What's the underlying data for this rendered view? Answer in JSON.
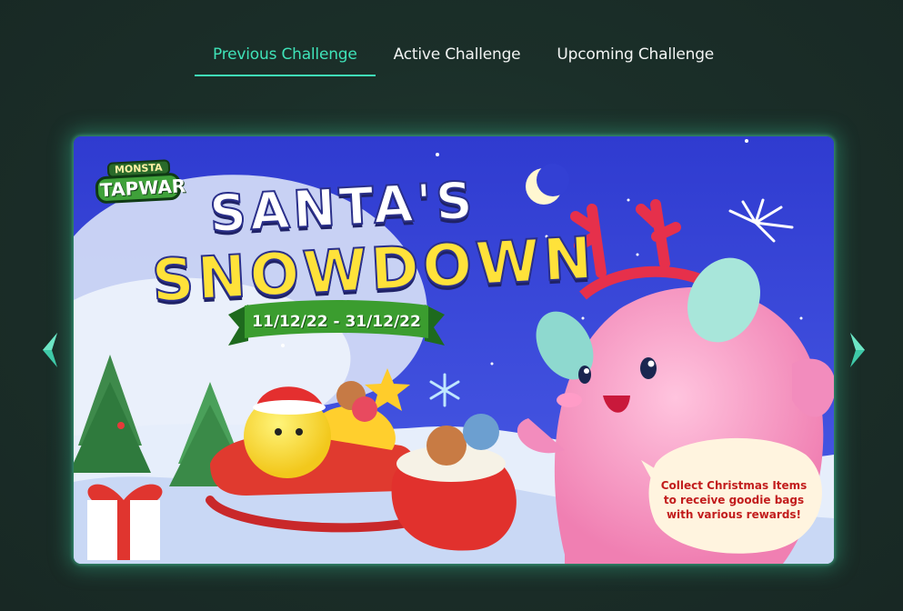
{
  "tabs": [
    {
      "label": "Previous Challenge",
      "active": true
    },
    {
      "label": "Active Challenge",
      "active": false
    },
    {
      "label": "Upcoming Challenge",
      "active": false
    }
  ],
  "colors": {
    "accent": "#3fe3b8",
    "background": "#1b2f29",
    "banner_sky": "#3b44d8"
  },
  "banner": {
    "logo_top": "MONSTA",
    "logo_main": "TAPWAR",
    "title_line1": "SANTA'S",
    "title_line2": "SNOWDOWN",
    "date_range": "11/12/22 - 31/12/22",
    "bubble_text": "Collect Christmas Items to receive goodie bags with various rewards!"
  },
  "icons": {
    "prev": "chevron-left-icon",
    "next": "chevron-right-icon"
  }
}
